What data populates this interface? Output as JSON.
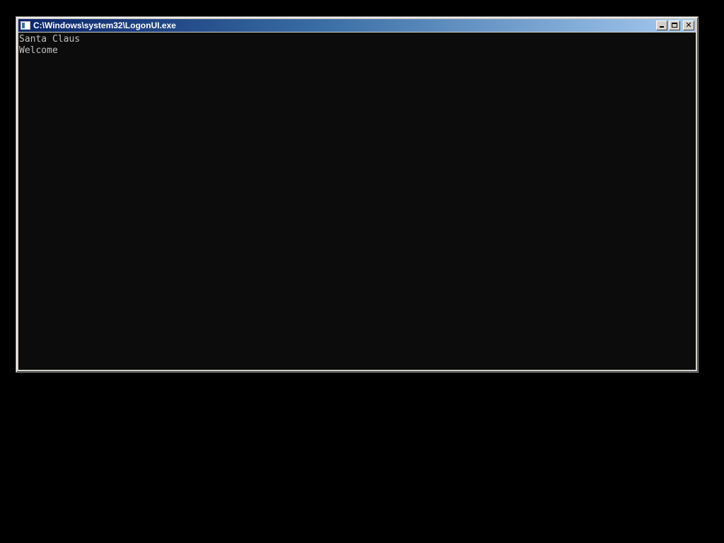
{
  "window": {
    "title": "C:\\Windows\\system32\\LogonUI.exe",
    "icon": "console-window-icon",
    "buttons": {
      "minimize": "minimize",
      "maximize": "maximize",
      "close": "close"
    }
  },
  "console": {
    "lines": [
      "Santa Claus",
      "Welcome"
    ]
  },
  "colors": {
    "desktop": "#000000",
    "console_background": "#0c0c0c",
    "console_text": "#c0c0c0",
    "titlebar_start": "#0a246a",
    "titlebar_end": "#a6caf0"
  }
}
